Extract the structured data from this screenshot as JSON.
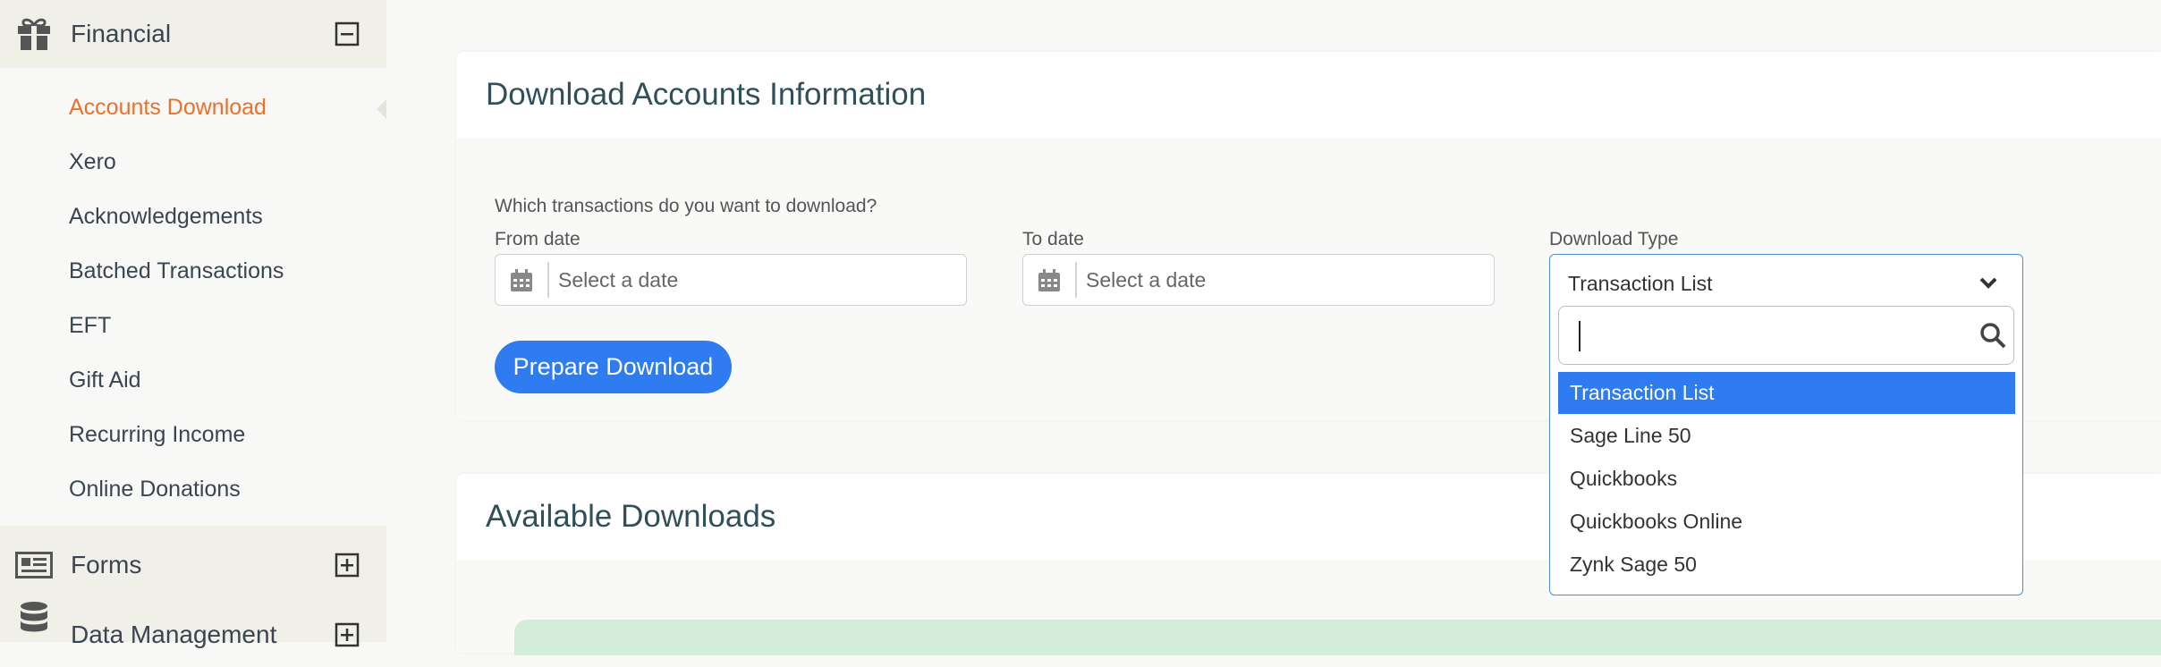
{
  "sidebar": {
    "financial": {
      "label": "Financial"
    },
    "items": [
      {
        "label": "Accounts Download"
      },
      {
        "label": "Xero"
      },
      {
        "label": "Acknowledgements"
      },
      {
        "label": "Batched Transactions"
      },
      {
        "label": "EFT"
      },
      {
        "label": "Gift Aid"
      },
      {
        "label": "Recurring Income"
      },
      {
        "label": "Online Donations"
      }
    ],
    "forms": {
      "label": "Forms"
    },
    "data_management": {
      "label": "Data Management"
    },
    "active_color": "#e8712b"
  },
  "download_panel": {
    "title": "Download Accounts Information",
    "question": "Which transactions do you want to download?",
    "from_label": "From date",
    "from_placeholder": "Select a date",
    "to_label": "To date",
    "to_placeholder": "Select a date",
    "type_label": "Download Type",
    "prepare_button": "Prepare Download"
  },
  "download_type": {
    "value": "Transaction List",
    "search_value": "",
    "options": [
      {
        "label": "Transaction List"
      },
      {
        "label": "Sage Line 50"
      },
      {
        "label": "Quickbooks"
      },
      {
        "label": "Quickbooks Online"
      },
      {
        "label": "Zynk Sage 50"
      }
    ]
  },
  "available_panel": {
    "title": "Available Downloads"
  },
  "colors": {
    "primary": "#2f7bf0",
    "accent": "#e8712b",
    "success_bg": "#d4edda"
  }
}
